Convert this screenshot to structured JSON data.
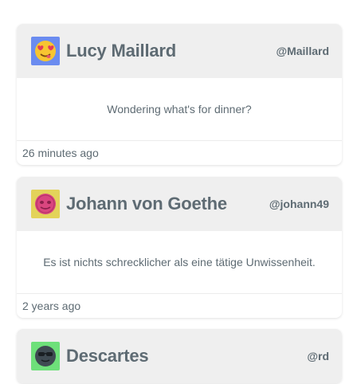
{
  "posts": [
    {
      "avatar_icon": "heart-eyes-emoji-icon",
      "avatar_bg": "#6b8cf0",
      "name": "Lucy Maillard",
      "handle": "@Maillard",
      "message": "Wondering what's for dinner?",
      "time": "26 minutes ago"
    },
    {
      "avatar_icon": "pink-face-emoji-icon",
      "avatar_bg": "#e3d35a",
      "name": "Johann von Goethe",
      "handle": "@johann49",
      "message": "Es ist nichts schrecklicher als eine tätige Unwissenheit.",
      "time": "2 years ago"
    },
    {
      "avatar_icon": "sunglasses-emoji-icon",
      "avatar_bg": "#6ee07a",
      "name": "Descartes",
      "handle": "@rd"
    }
  ]
}
